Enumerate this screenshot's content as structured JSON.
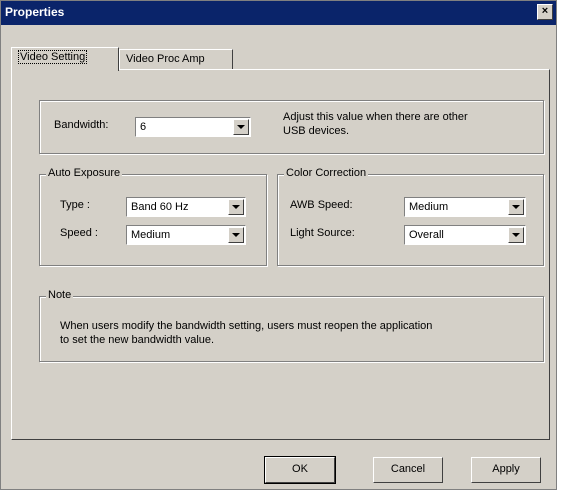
{
  "window": {
    "title": "Properties",
    "close_glyph": "×"
  },
  "tabs": [
    {
      "label": "Video Setting",
      "active": true
    },
    {
      "label": "Video Proc Amp",
      "active": false
    }
  ],
  "bandwidth": {
    "label": "Bandwidth:",
    "value": "6",
    "hint_line1": "Adjust this value when there are other",
    "hint_line2": "USB devices."
  },
  "auto_exposure": {
    "title": "Auto Exposure",
    "type_label": "Type :",
    "type_value": "Band 60 Hz",
    "speed_label": "Speed :",
    "speed_value": "Medium"
  },
  "color_correction": {
    "title": "Color Correction",
    "awb_label": "AWB Speed:",
    "awb_value": "Medium",
    "light_label": "Light Source:",
    "light_value": "Overall"
  },
  "note": {
    "title": "Note",
    "line1": "When users modify the bandwidth setting, users must reopen the application",
    "line2": "to set the new bandwidth value."
  },
  "buttons": {
    "ok": "OK",
    "cancel": "Cancel",
    "apply": "Apply"
  }
}
